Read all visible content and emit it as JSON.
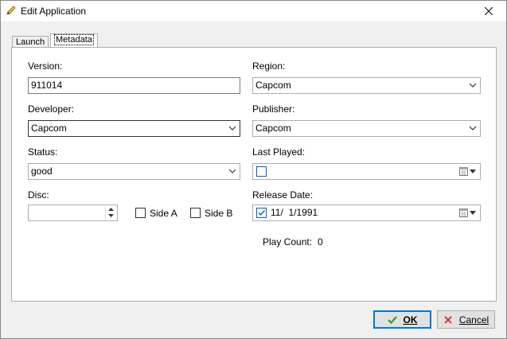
{
  "window": {
    "title": "Edit Application"
  },
  "tabs": [
    {
      "label": "Launch"
    },
    {
      "label": "Metadata"
    }
  ],
  "form": {
    "version": {
      "label": "Version:",
      "value": "911014"
    },
    "region": {
      "label": "Region:",
      "value": "Capcom"
    },
    "developer": {
      "label": "Developer:",
      "value": "Capcom"
    },
    "publisher": {
      "label": "Publisher:",
      "value": "Capcom"
    },
    "status": {
      "label": "Status:",
      "value": "good"
    },
    "last_played": {
      "label": "Last Played:",
      "value": "",
      "checked": false
    },
    "disc": {
      "label": "Disc:",
      "value": ""
    },
    "side_a": {
      "label": "Side A",
      "checked": false
    },
    "side_b": {
      "label": "Side B",
      "checked": false
    },
    "release_date": {
      "label": "Release Date:",
      "value": "11/  1/1991",
      "checked": true
    },
    "play_count": {
      "label": "Play Count:",
      "value": "0"
    }
  },
  "buttons": {
    "ok": "OK",
    "cancel": "Cancel"
  },
  "colors": {
    "accent": "#0078d7",
    "ok_check": "#2e9e2e",
    "cancel_x": "#d83b3b"
  },
  "icons": {
    "title": "pencil-icon",
    "close": "close-icon",
    "calendar": "calendar-icon"
  }
}
